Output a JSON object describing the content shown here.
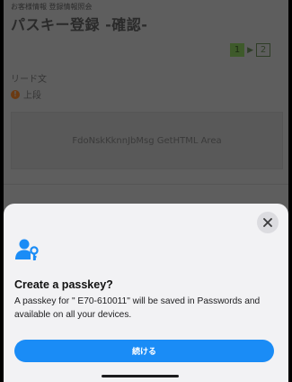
{
  "page": {
    "breadcrumb": "お客様情報 登録情報照会",
    "title": "パスキー登録 -確認-",
    "steps": [
      {
        "label": "1",
        "active": true
      },
      {
        "label": "2",
        "active": false
      }
    ],
    "step_arrow": "▶",
    "lead_label": "リード文",
    "warning": {
      "icon": "!",
      "label": "上段"
    },
    "html_area_text": "FdoNskKknnJbMsg GetHTML Area"
  },
  "sheet": {
    "title": "Create a passkey?",
    "description": "A passkey for \" E70-610011\" will be saved in Passwords and available on all your devices.",
    "continue_label": "続ける",
    "accent_color": "#1a8cf6"
  }
}
